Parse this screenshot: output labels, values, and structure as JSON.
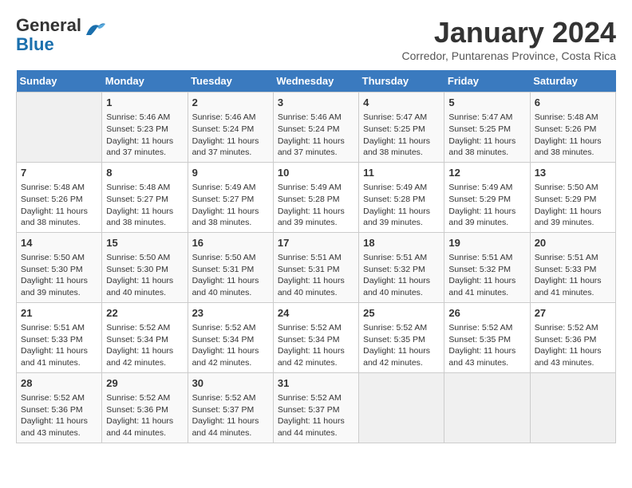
{
  "header": {
    "logo_line1": "General",
    "logo_line2": "Blue",
    "title": "January 2024",
    "subtitle": "Corredor, Puntarenas Province, Costa Rica"
  },
  "days_of_week": [
    "Sunday",
    "Monday",
    "Tuesday",
    "Wednesday",
    "Thursday",
    "Friday",
    "Saturday"
  ],
  "weeks": [
    [
      {
        "day": "",
        "info": ""
      },
      {
        "day": "1",
        "info": "Sunrise: 5:46 AM\nSunset: 5:23 PM\nDaylight: 11 hours\nand 37 minutes."
      },
      {
        "day": "2",
        "info": "Sunrise: 5:46 AM\nSunset: 5:24 PM\nDaylight: 11 hours\nand 37 minutes."
      },
      {
        "day": "3",
        "info": "Sunrise: 5:46 AM\nSunset: 5:24 PM\nDaylight: 11 hours\nand 37 minutes."
      },
      {
        "day": "4",
        "info": "Sunrise: 5:47 AM\nSunset: 5:25 PM\nDaylight: 11 hours\nand 38 minutes."
      },
      {
        "day": "5",
        "info": "Sunrise: 5:47 AM\nSunset: 5:25 PM\nDaylight: 11 hours\nand 38 minutes."
      },
      {
        "day": "6",
        "info": "Sunrise: 5:48 AM\nSunset: 5:26 PM\nDaylight: 11 hours\nand 38 minutes."
      }
    ],
    [
      {
        "day": "7",
        "info": "Sunrise: 5:48 AM\nSunset: 5:26 PM\nDaylight: 11 hours\nand 38 minutes."
      },
      {
        "day": "8",
        "info": "Sunrise: 5:48 AM\nSunset: 5:27 PM\nDaylight: 11 hours\nand 38 minutes."
      },
      {
        "day": "9",
        "info": "Sunrise: 5:49 AM\nSunset: 5:27 PM\nDaylight: 11 hours\nand 38 minutes."
      },
      {
        "day": "10",
        "info": "Sunrise: 5:49 AM\nSunset: 5:28 PM\nDaylight: 11 hours\nand 39 minutes."
      },
      {
        "day": "11",
        "info": "Sunrise: 5:49 AM\nSunset: 5:28 PM\nDaylight: 11 hours\nand 39 minutes."
      },
      {
        "day": "12",
        "info": "Sunrise: 5:49 AM\nSunset: 5:29 PM\nDaylight: 11 hours\nand 39 minutes."
      },
      {
        "day": "13",
        "info": "Sunrise: 5:50 AM\nSunset: 5:29 PM\nDaylight: 11 hours\nand 39 minutes."
      }
    ],
    [
      {
        "day": "14",
        "info": "Sunrise: 5:50 AM\nSunset: 5:30 PM\nDaylight: 11 hours\nand 39 minutes."
      },
      {
        "day": "15",
        "info": "Sunrise: 5:50 AM\nSunset: 5:30 PM\nDaylight: 11 hours\nand 40 minutes."
      },
      {
        "day": "16",
        "info": "Sunrise: 5:50 AM\nSunset: 5:31 PM\nDaylight: 11 hours\nand 40 minutes."
      },
      {
        "day": "17",
        "info": "Sunrise: 5:51 AM\nSunset: 5:31 PM\nDaylight: 11 hours\nand 40 minutes."
      },
      {
        "day": "18",
        "info": "Sunrise: 5:51 AM\nSunset: 5:32 PM\nDaylight: 11 hours\nand 40 minutes."
      },
      {
        "day": "19",
        "info": "Sunrise: 5:51 AM\nSunset: 5:32 PM\nDaylight: 11 hours\nand 41 minutes."
      },
      {
        "day": "20",
        "info": "Sunrise: 5:51 AM\nSunset: 5:33 PM\nDaylight: 11 hours\nand 41 minutes."
      }
    ],
    [
      {
        "day": "21",
        "info": "Sunrise: 5:51 AM\nSunset: 5:33 PM\nDaylight: 11 hours\nand 41 minutes."
      },
      {
        "day": "22",
        "info": "Sunrise: 5:52 AM\nSunset: 5:34 PM\nDaylight: 11 hours\nand 42 minutes."
      },
      {
        "day": "23",
        "info": "Sunrise: 5:52 AM\nSunset: 5:34 PM\nDaylight: 11 hours\nand 42 minutes."
      },
      {
        "day": "24",
        "info": "Sunrise: 5:52 AM\nSunset: 5:34 PM\nDaylight: 11 hours\nand 42 minutes."
      },
      {
        "day": "25",
        "info": "Sunrise: 5:52 AM\nSunset: 5:35 PM\nDaylight: 11 hours\nand 42 minutes."
      },
      {
        "day": "26",
        "info": "Sunrise: 5:52 AM\nSunset: 5:35 PM\nDaylight: 11 hours\nand 43 minutes."
      },
      {
        "day": "27",
        "info": "Sunrise: 5:52 AM\nSunset: 5:36 PM\nDaylight: 11 hours\nand 43 minutes."
      }
    ],
    [
      {
        "day": "28",
        "info": "Sunrise: 5:52 AM\nSunset: 5:36 PM\nDaylight: 11 hours\nand 43 minutes."
      },
      {
        "day": "29",
        "info": "Sunrise: 5:52 AM\nSunset: 5:36 PM\nDaylight: 11 hours\nand 44 minutes."
      },
      {
        "day": "30",
        "info": "Sunrise: 5:52 AM\nSunset: 5:37 PM\nDaylight: 11 hours\nand 44 minutes."
      },
      {
        "day": "31",
        "info": "Sunrise: 5:52 AM\nSunset: 5:37 PM\nDaylight: 11 hours\nand 44 minutes."
      },
      {
        "day": "",
        "info": ""
      },
      {
        "day": "",
        "info": ""
      },
      {
        "day": "",
        "info": ""
      }
    ]
  ]
}
